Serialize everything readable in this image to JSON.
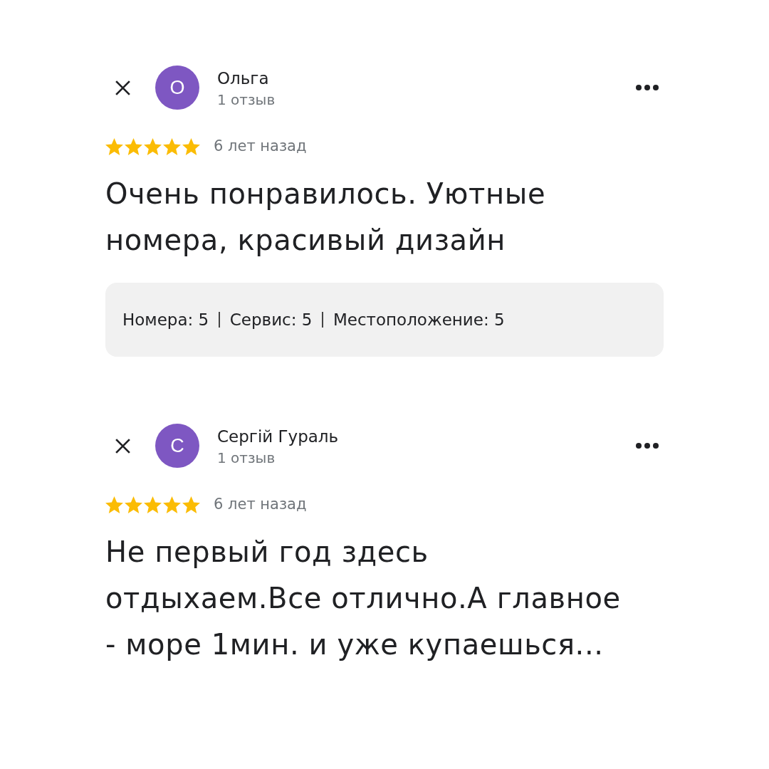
{
  "reviews": [
    {
      "author": "Ольга",
      "avatar_letter": "О",
      "review_count": "1 отзыв",
      "stars": 5,
      "time": "6 лет назад",
      "text": "Очень понравилось. Уютные\nномера, красивый дизайн",
      "ratings": [
        "Номера: 5",
        "Сервис: 5",
        "Местоположение: 5"
      ]
    },
    {
      "author": "Сергій Гураль",
      "avatar_letter": "С",
      "review_count": "1 отзыв",
      "stars": 5,
      "time": "6 лет назад",
      "text": "Не первый год здесь\nотдыхаем.Все отлично.А главное\n- море 1мин. и уже купаешься..."
    }
  ]
}
